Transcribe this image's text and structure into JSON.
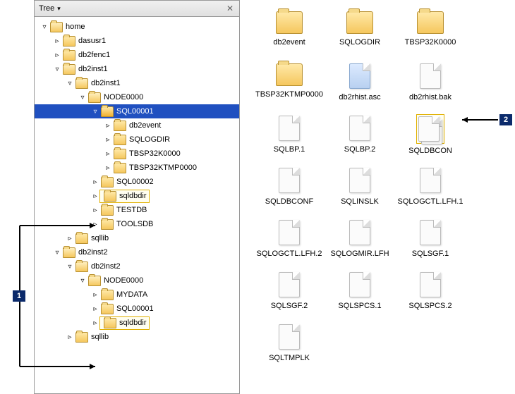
{
  "panel_title": "Tree",
  "tree": [
    {
      "depth": 0,
      "state": "open",
      "label": "home",
      "sel": false,
      "hl": false
    },
    {
      "depth": 1,
      "state": "closed",
      "label": "dasusr1",
      "sel": false,
      "hl": false
    },
    {
      "depth": 1,
      "state": "closed",
      "label": "db2fenc1",
      "sel": false,
      "hl": false
    },
    {
      "depth": 1,
      "state": "open",
      "label": "db2inst1",
      "sel": false,
      "hl": false
    },
    {
      "depth": 2,
      "state": "open",
      "label": "db2inst1",
      "sel": false,
      "hl": false
    },
    {
      "depth": 3,
      "state": "open",
      "label": "NODE0000",
      "sel": false,
      "hl": false
    },
    {
      "depth": 4,
      "state": "open",
      "label": "SQL00001",
      "sel": true,
      "hl": false
    },
    {
      "depth": 5,
      "state": "closed",
      "label": "db2event",
      "sel": false,
      "hl": false
    },
    {
      "depth": 5,
      "state": "closed",
      "label": "SQLOGDIR",
      "sel": false,
      "hl": false
    },
    {
      "depth": 5,
      "state": "closed",
      "label": "TBSP32K0000",
      "sel": false,
      "hl": false
    },
    {
      "depth": 5,
      "state": "closed",
      "label": "TBSP32KTMP0000",
      "sel": false,
      "hl": false
    },
    {
      "depth": 4,
      "state": "closed",
      "label": "SQL00002",
      "sel": false,
      "hl": false
    },
    {
      "depth": 4,
      "state": "closed",
      "label": "sqldbdir",
      "sel": false,
      "hl": true
    },
    {
      "depth": 4,
      "state": "closed",
      "label": "TESTDB",
      "sel": false,
      "hl": false
    },
    {
      "depth": 4,
      "state": "closed",
      "label": "TOOLSDB",
      "sel": false,
      "hl": false
    },
    {
      "depth": 2,
      "state": "closed",
      "label": "sqllib",
      "sel": false,
      "hl": false
    },
    {
      "depth": 1,
      "state": "open",
      "label": "db2inst2",
      "sel": false,
      "hl": false
    },
    {
      "depth": 2,
      "state": "open",
      "label": "db2inst2",
      "sel": false,
      "hl": false
    },
    {
      "depth": 3,
      "state": "open",
      "label": "NODE0000",
      "sel": false,
      "hl": false
    },
    {
      "depth": 4,
      "state": "closed",
      "label": "MYDATA",
      "sel": false,
      "hl": false
    },
    {
      "depth": 4,
      "state": "closed",
      "label": "SQL00001",
      "sel": false,
      "hl": false
    },
    {
      "depth": 4,
      "state": "closed",
      "label": "sqldbdir",
      "sel": false,
      "hl": true
    },
    {
      "depth": 2,
      "state": "closed",
      "label": "sqllib",
      "sel": false,
      "hl": false
    }
  ],
  "content": [
    {
      "type": "folder",
      "label": "db2event",
      "sel": false
    },
    {
      "type": "folder",
      "label": "SQLOGDIR",
      "sel": false
    },
    {
      "type": "folder",
      "label": "TBSP32K0000",
      "sel": false
    },
    {
      "type": "folder",
      "label": "TBSP32KTMP0000",
      "sel": false
    },
    {
      "type": "bluedoc",
      "label": "db2rhist.asc",
      "sel": false
    },
    {
      "type": "doc",
      "label": "db2rhist.bak",
      "sel": false
    },
    {
      "type": "doc",
      "label": "SQLBP.1",
      "sel": false
    },
    {
      "type": "doc",
      "label": "SQLBP.2",
      "sel": false
    },
    {
      "type": "stack",
      "label": "SQLDBCON",
      "sel": true
    },
    {
      "type": "doc",
      "label": "SQLDBCONF",
      "sel": false
    },
    {
      "type": "doc",
      "label": "SQLINSLK",
      "sel": false
    },
    {
      "type": "doc",
      "label": "SQLOGCTL.LFH.1",
      "sel": false
    },
    {
      "type": "doc",
      "label": "SQLOGCTL.LFH.2",
      "sel": false
    },
    {
      "type": "doc",
      "label": "SQLOGMIR.LFH",
      "sel": false
    },
    {
      "type": "doc",
      "label": "SQLSGF.1",
      "sel": false
    },
    {
      "type": "doc",
      "label": "SQLSGF.2",
      "sel": false
    },
    {
      "type": "doc",
      "label": "SQLSPCS.1",
      "sel": false
    },
    {
      "type": "doc",
      "label": "SQLSPCS.2",
      "sel": false
    },
    {
      "type": "doc",
      "label": "SQLTMPLK",
      "sel": false
    }
  ],
  "callouts": {
    "left": "1",
    "right": "2"
  }
}
